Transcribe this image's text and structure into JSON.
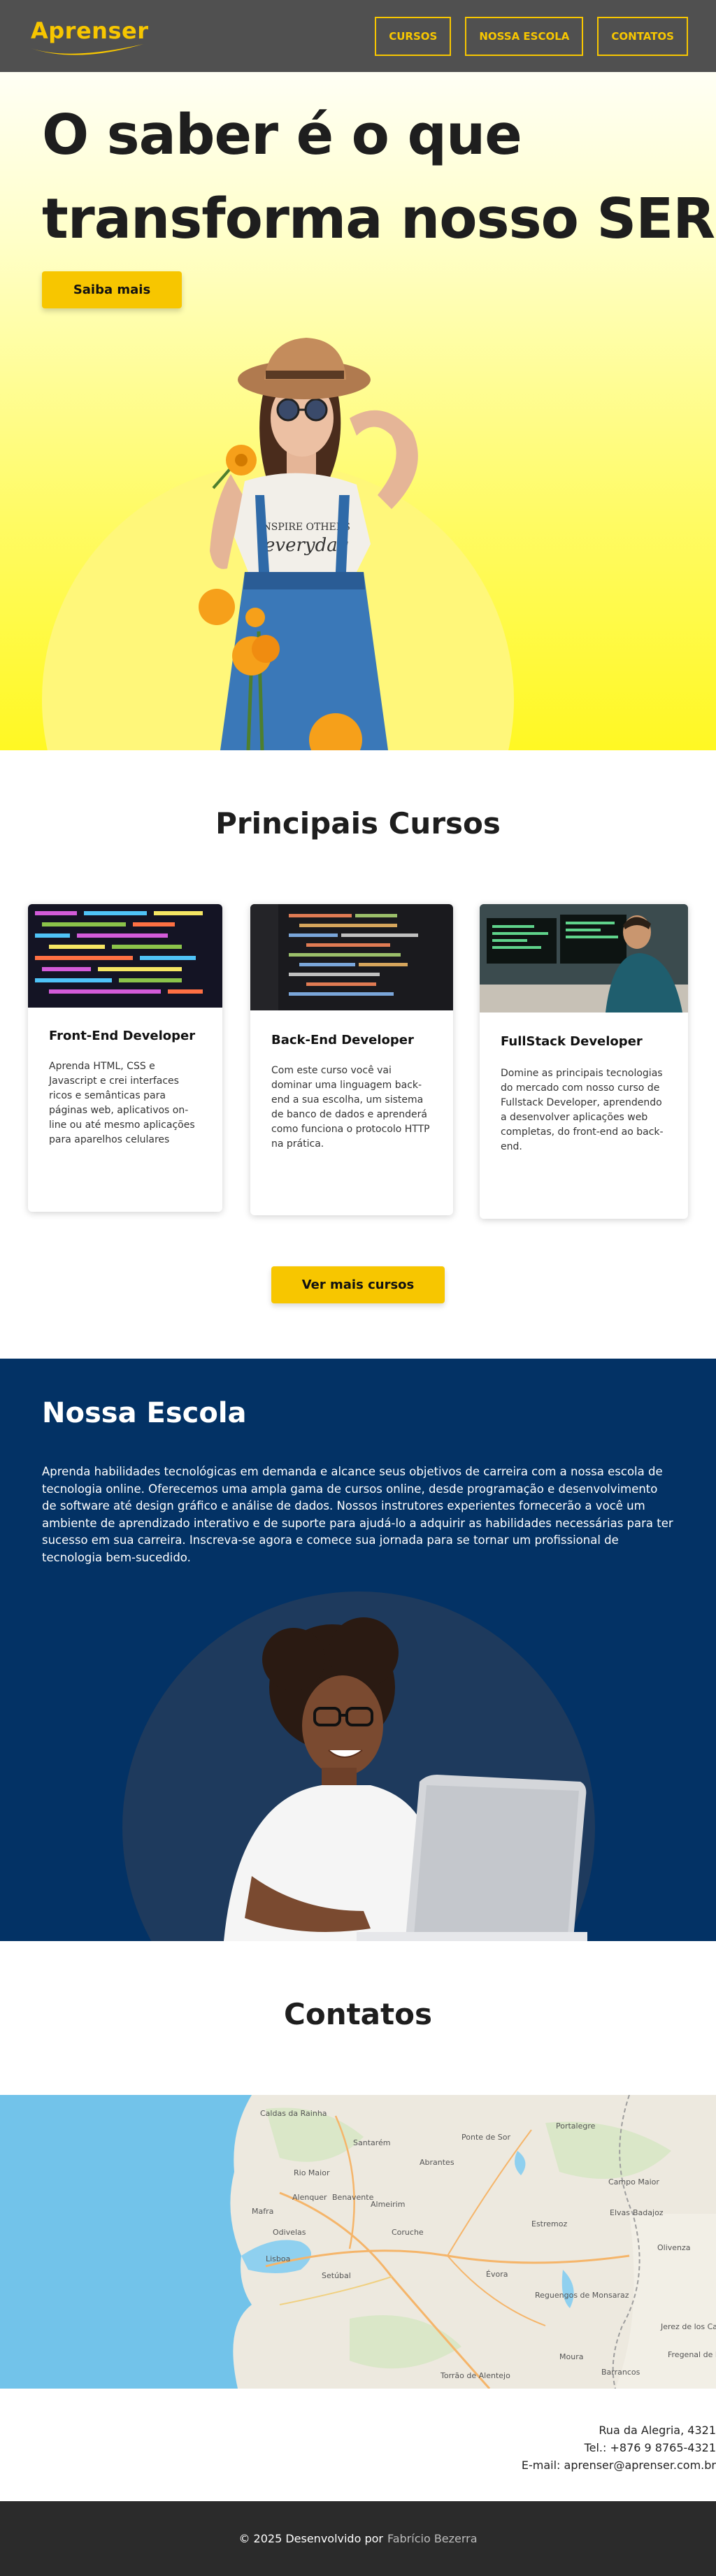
{
  "header": {
    "logo": "Aprenser",
    "nav": [
      "CURSOS",
      "NOSSA ESCOLA",
      "CONTATOS"
    ]
  },
  "hero": {
    "title_line1": "O saber é o que",
    "title_line2": "transforma nosso SER",
    "cta": "Saiba mais",
    "shirt_text_line1": "INSPIRE OTHERS",
    "shirt_text_line2": "everyday"
  },
  "courses": {
    "title": "Principais Cursos",
    "items": [
      {
        "title": "Front-End Developer",
        "description": "Aprenda HTML, CSS e Javascript e crei interfaces ricos e semânticas para páginas web, aplicativos on-line ou até mesmo aplicações para aparelhos celulares"
      },
      {
        "title": "Back-End Developer",
        "description": "Com este curso você vai dominar uma linguagem back-end a sua escolha, um sistema de banco de dados e aprenderá como funciona o protocolo HTTP na prática."
      },
      {
        "title": "FullStack Developer",
        "description": "Domine as principais tecnologias do mercado com nosso curso de Fullstack Developer, aprendendo a desenvolver aplicações web completas, do front-end ao back-end."
      }
    ],
    "more": "Ver mais cursos"
  },
  "school": {
    "title": "Nossa Escola",
    "text": "Aprenda habilidades tecnológicas em demanda e alcance seus objetivos de carreira com a nossa escola de tecnologia online. Oferecemos uma ampla gama de cursos online, desde programação e desenvolvimento de software até design gráfico e análise de dados. Nossos instrutores experientes fornecerão a você um ambiente de aprendizado interativo e de suporte para ajudá-lo a adquirir as habilidades necessárias para ter sucesso em sua carreira. Inscreva-se agora e comece sua jornada para se tornar um profissional de tecnologia bem-sucedido."
  },
  "contact": {
    "title": "Contatos",
    "map_labels": [
      "Santarém",
      "Ponte de Sor",
      "Portalegre",
      "Abrantes",
      "Caldas da Rainha",
      "Almeirim",
      "Campo Maior",
      "Elvas",
      "Badajoz",
      "Mafra",
      "Benavente",
      "Estremoz",
      "Olivenza",
      "Odivelas",
      "Lisboa",
      "Évora",
      "Setúbal",
      "Reguengos de Monsaraz",
      "Jerez de los Caballeros",
      "Fregenal de la Sierra",
      "Moura",
      "Torrão de Alentejo",
      "Barrancos",
      "Rio Maior",
      "Alenquer",
      "Coruche"
    ],
    "address_line1": "Rua da Alegria, 4321",
    "address_line2": "Tel.: +876 9 8765-4321",
    "address_line3": "E-mail: aprenser@aprenser.com.br"
  },
  "footer": {
    "text": "© 2025 Desenvolvido por",
    "author": "Fabrício Bezerra"
  },
  "colors": {
    "accent": "#f7c600",
    "header_bg": "#505050",
    "school_bg": "#033265",
    "footer_bg": "#2b2b2b"
  }
}
